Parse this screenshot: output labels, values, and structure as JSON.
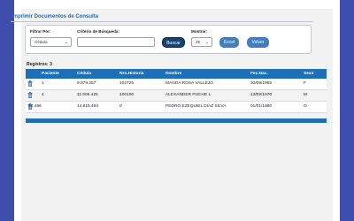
{
  "page": {
    "title": "Imprimir Documentos de Consulta"
  },
  "filters": {
    "filter_by_label": "Filtrar Por:",
    "filter_by_value": "Cédula",
    "search_label": "Criterio de Búsqueda:",
    "search_value": "",
    "show_label": "Mostrar:",
    "show_value": "25",
    "search_button": "Buscar",
    "excel_button": "Excel",
    "back_button": "Volver"
  },
  "results": {
    "count_label": "Registros: 3"
  },
  "table": {
    "columns": [
      "Paciente",
      "Cédula",
      "Nro.Historia",
      "Nombre",
      "Fec.Nac.",
      "Sexo"
    ],
    "rows": [
      {
        "paciente": "1",
        "cedula": "9.979.257",
        "historia": "102725",
        "nombre": "MAGDA ROSA VALLEJO",
        "fecnac": "30/09/1965",
        "sexo": "F"
      },
      {
        "paciente": "4",
        "cedula": "11.005.425",
        "historia": "100100",
        "nombre": "ALEXANDER PUCHE L",
        "fecnac": "13/09/1970",
        "sexo": "M"
      },
      {
        "paciente": "44.496",
        "cedula": "14.815.464",
        "historia": "0",
        "nombre": "PEDRO EZEQUIEL DIAZ SILVA",
        "fecnac": "01/01/1980",
        "sexo": "O"
      }
    ]
  },
  "colors": {
    "accent": "#1f6fb6",
    "background": "#3f4dae"
  }
}
